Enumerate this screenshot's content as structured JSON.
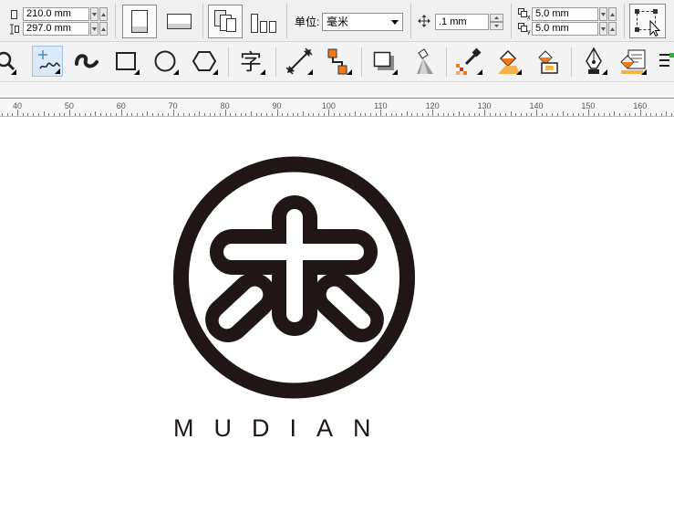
{
  "property_bar": {
    "page_width": "210.0 mm",
    "page_height": "297.0 mm",
    "unit_label": "单位:",
    "unit_value": "毫米",
    "nudge_value": ".1 mm",
    "duplicate_x": "5.0 mm",
    "duplicate_y": "5.0 mm"
  },
  "ruler": {
    "labels": [
      "40",
      "50",
      "60",
      "70",
      "80",
      "90",
      "100",
      "110",
      "120",
      "130",
      "140",
      "150",
      "160"
    ]
  },
  "canvas": {
    "logo_text": "MUDIAN",
    "logo_color": "#1f1615"
  },
  "colors": {
    "accent_line": "#27b3b8",
    "active_tool_bg": "#dbe9f8"
  }
}
